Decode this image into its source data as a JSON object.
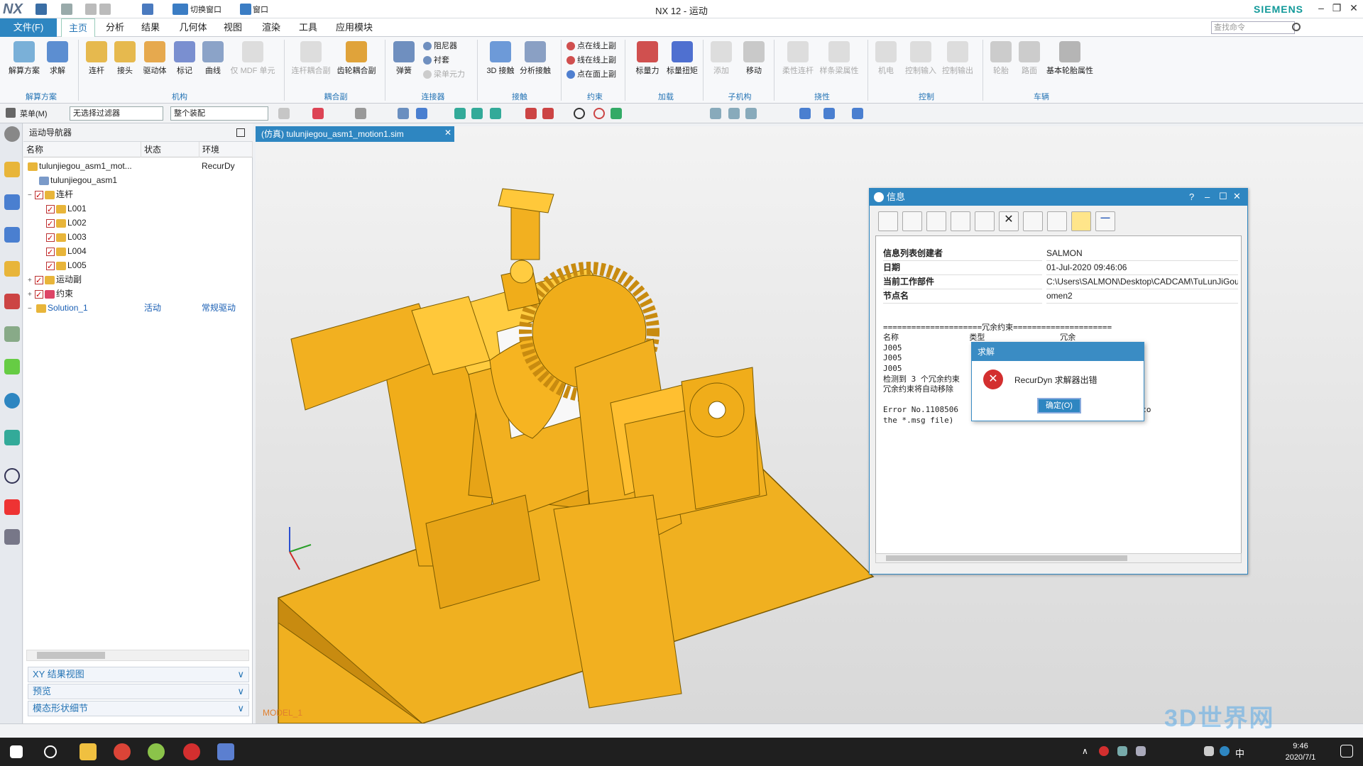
{
  "window": {
    "app_logo": "NX",
    "title": "NX 12 - 运动",
    "brand": "SIEMENS",
    "switch_window": "切换窗口",
    "window_menu": "窗口"
  },
  "menu": {
    "file": "文件(F)",
    "tabs": [
      "主页",
      "分析",
      "结果",
      "几何体",
      "视图",
      "渲染",
      "工具",
      "应用模块"
    ],
    "search_placeholder": "查找命令"
  },
  "ribbon": {
    "buttons": [
      "解算方案",
      "求解",
      "连杆",
      "接头",
      "驱动体",
      "标记",
      "曲线",
      "仅 MDF 单元",
      "连杆耦合副",
      "齿轮耦合副",
      "弹簧",
      "3D 接触",
      "分析接触",
      "标量力",
      "标量扭矩",
      "添加",
      "移动",
      "柔性连杆",
      "样条梁属性",
      "机电",
      "控制输入",
      "控制输出",
      "轮胎",
      "路面",
      "基本轮胎属性"
    ],
    "small": [
      "阻尼器",
      "衬套",
      "梁单元力",
      "点在线上副",
      "线在线上副",
      "点在面上副"
    ],
    "groups": [
      "解算方案",
      "机构",
      "耦合副",
      "连接器",
      "接触",
      "约束",
      "加载",
      "子机构",
      "挠性",
      "控制",
      "车辆"
    ]
  },
  "toolbar2": {
    "menu": "菜单(M)",
    "filter": "无选择过滤器",
    "assembly": "整个装配"
  },
  "navigator": {
    "title": "运动导航器",
    "columns": [
      "名称",
      "状态",
      "环境"
    ],
    "rows": [
      {
        "name": "tulunjiegou_asm1_mot...",
        "status": "",
        "env": "RecurDy"
      },
      {
        "name": "tulunjiegou_asm1",
        "status": "",
        "env": ""
      },
      {
        "name": "连杆",
        "status": "",
        "env": ""
      },
      {
        "name": "L001",
        "status": "",
        "env": ""
      },
      {
        "name": "L002",
        "status": "",
        "env": ""
      },
      {
        "name": "L003",
        "status": "",
        "env": ""
      },
      {
        "name": "L004",
        "status": "",
        "env": ""
      },
      {
        "name": "L005",
        "status": "",
        "env": ""
      },
      {
        "name": "运动副",
        "status": "",
        "env": ""
      },
      {
        "name": "约束",
        "status": "",
        "env": ""
      },
      {
        "name": "Solution_1",
        "status": "活动",
        "env": "常规驱动"
      }
    ],
    "panels": [
      "XY 结果视图",
      "预览",
      "模态形状细节"
    ]
  },
  "graphics": {
    "tab": "(仿真) tulunjiegou_asm1_motion1.sim",
    "model_label": "MODEL_1"
  },
  "info": {
    "title": "信息",
    "fields": [
      {
        "k": "信息列表创建者",
        "v": "SALMON"
      },
      {
        "k": "日期",
        "v": "01-Jul-2020 09:46:06"
      },
      {
        "k": "当前工作部件",
        "v": "C:\\Users\\SALMON\\Desktop\\CADCAM\\TuLunJiGou\\"
      },
      {
        "k": "节点名",
        "v": "omen2"
      }
    ],
    "lines": [
      "=====================冗余约束=====================",
      "名称               类型                冗余",
      "J005",
      "J005",
      "J005",
      "检测到 3 个冗余约束",
      "冗余约束将自动移除",
      "",
      "Error No.1108506                          iled. (refer to",
      "the *.msg file)"
    ]
  },
  "error_dialog": {
    "title": "求解",
    "message": "RecurDyn 求解器出错",
    "ok": "确定(O)"
  },
  "taskbar": {
    "time": "9:46",
    "date": "2020/7/1",
    "ime": "中"
  },
  "watermark": "3D世界网"
}
